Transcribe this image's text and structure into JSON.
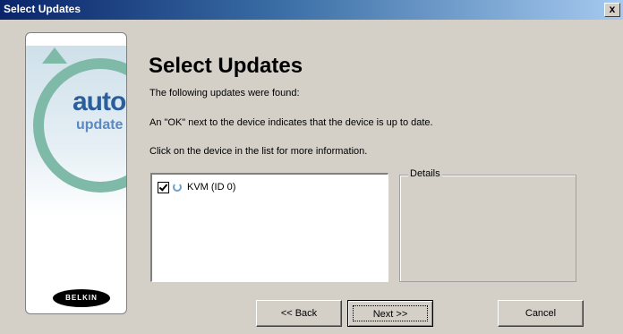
{
  "window": {
    "title": "Select Updates",
    "close_label": "x"
  },
  "banner": {
    "logo_word1": "auto",
    "logo_word2": "update",
    "brand": "BELKIN"
  },
  "content": {
    "heading": "Select Updates",
    "line1": "The following updates were found:",
    "line2": "An \"OK\" next to the device indicates that the device is up to date.",
    "line3": "Click on the device in the list for more information."
  },
  "device_list": [
    {
      "label": "KVM (ID 0)",
      "checked": true
    }
  ],
  "details": {
    "legend": "Details"
  },
  "buttons": {
    "back": "<< Back",
    "next": "Next >>",
    "cancel": "Cancel"
  }
}
